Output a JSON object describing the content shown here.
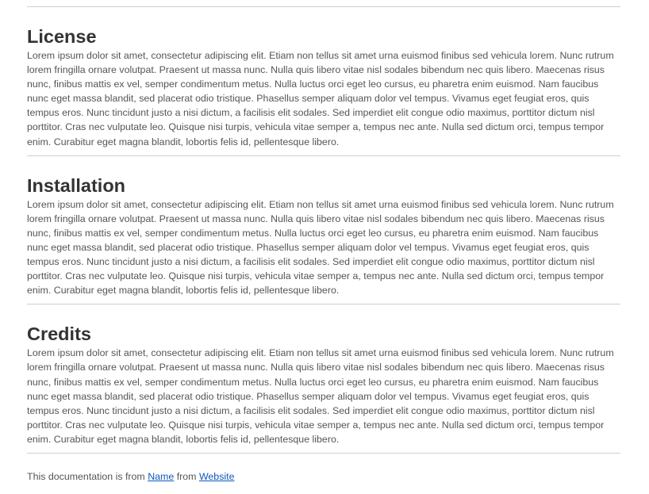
{
  "sections": [
    {
      "title": "License",
      "body": "Lorem ipsum dolor sit amet, consectetur adipiscing elit. Etiam non tellus sit amet urna euismod finibus sed vehicula lorem. Nunc rutrum lorem fringilla ornare volutpat. Praesent ut massa nunc. Nulla quis libero vitae nisl sodales bibendum nec quis libero. Maecenas risus nunc, finibus mattis ex vel, semper condimentum metus. Nulla luctus orci eget leo cursus, eu pharetra enim euismod. Nam faucibus nunc eget massa blandit, sed placerat odio tristique. Phasellus semper aliquam dolor vel tempus. Vivamus eget feugiat eros, quis tempus eros. Nunc tincidunt justo a nisi dictum, a facilisis elit sodales. Sed imperdiet elit congue odio maximus, porttitor dictum nisl porttitor. Cras nec vulputate leo. Quisque nisi turpis, vehicula vitae semper a, tempus nec ante. Nulla sed dictum orci, tempus tempor enim. Curabitur eget magna blandit, lobortis felis id, pellentesque libero."
    },
    {
      "title": "Installation",
      "body": "Lorem ipsum dolor sit amet, consectetur adipiscing elit. Etiam non tellus sit amet urna euismod finibus sed vehicula lorem. Nunc rutrum lorem fringilla ornare volutpat. Praesent ut massa nunc. Nulla quis libero vitae nisl sodales bibendum nec quis libero. Maecenas risus nunc, finibus mattis ex vel, semper condimentum metus. Nulla luctus orci eget leo cursus, eu pharetra enim euismod. Nam faucibus nunc eget massa blandit, sed placerat odio tristique. Phasellus semper aliquam dolor vel tempus. Vivamus eget feugiat eros, quis tempus eros. Nunc tincidunt justo a nisi dictum, a facilisis elit sodales. Sed imperdiet elit congue odio maximus, porttitor dictum nisl porttitor. Cras nec vulputate leo. Quisque nisi turpis, vehicula vitae semper a, tempus nec ante. Nulla sed dictum orci, tempus tempor enim. Curabitur eget magna blandit, lobortis felis id, pellentesque libero."
    },
    {
      "title": "Credits",
      "body": "Lorem ipsum dolor sit amet, consectetur adipiscing elit. Etiam non tellus sit amet urna euismod finibus sed vehicula lorem. Nunc rutrum lorem fringilla ornare volutpat. Praesent ut massa nunc. Nulla quis libero vitae nisl sodales bibendum nec quis libero. Maecenas risus nunc, finibus mattis ex vel, semper condimentum metus. Nulla luctus orci eget leo cursus, eu pharetra enim euismod. Nam faucibus nunc eget massa blandit, sed placerat odio tristique. Phasellus semper aliquam dolor vel tempus. Vivamus eget feugiat eros, quis tempus eros. Nunc tincidunt justo a nisi dictum, a facilisis elit sodales. Sed imperdiet elit congue odio maximus, porttitor dictum nisl porttitor. Cras nec vulputate leo. Quisque nisi turpis, vehicula vitae semper a, tempus nec ante. Nulla sed dictum orci, tempus tempor enim. Curabitur eget magna blandit, lobortis felis id, pellentesque libero."
    }
  ],
  "footer": {
    "prefix": "This documentation is from ",
    "name_link": "Name",
    "middle": " from ",
    "website_link": "Website"
  },
  "colors": {
    "link": "#0d58c0",
    "heading": "#333333",
    "body_text": "#555555",
    "divider": "#cfcfcf"
  }
}
